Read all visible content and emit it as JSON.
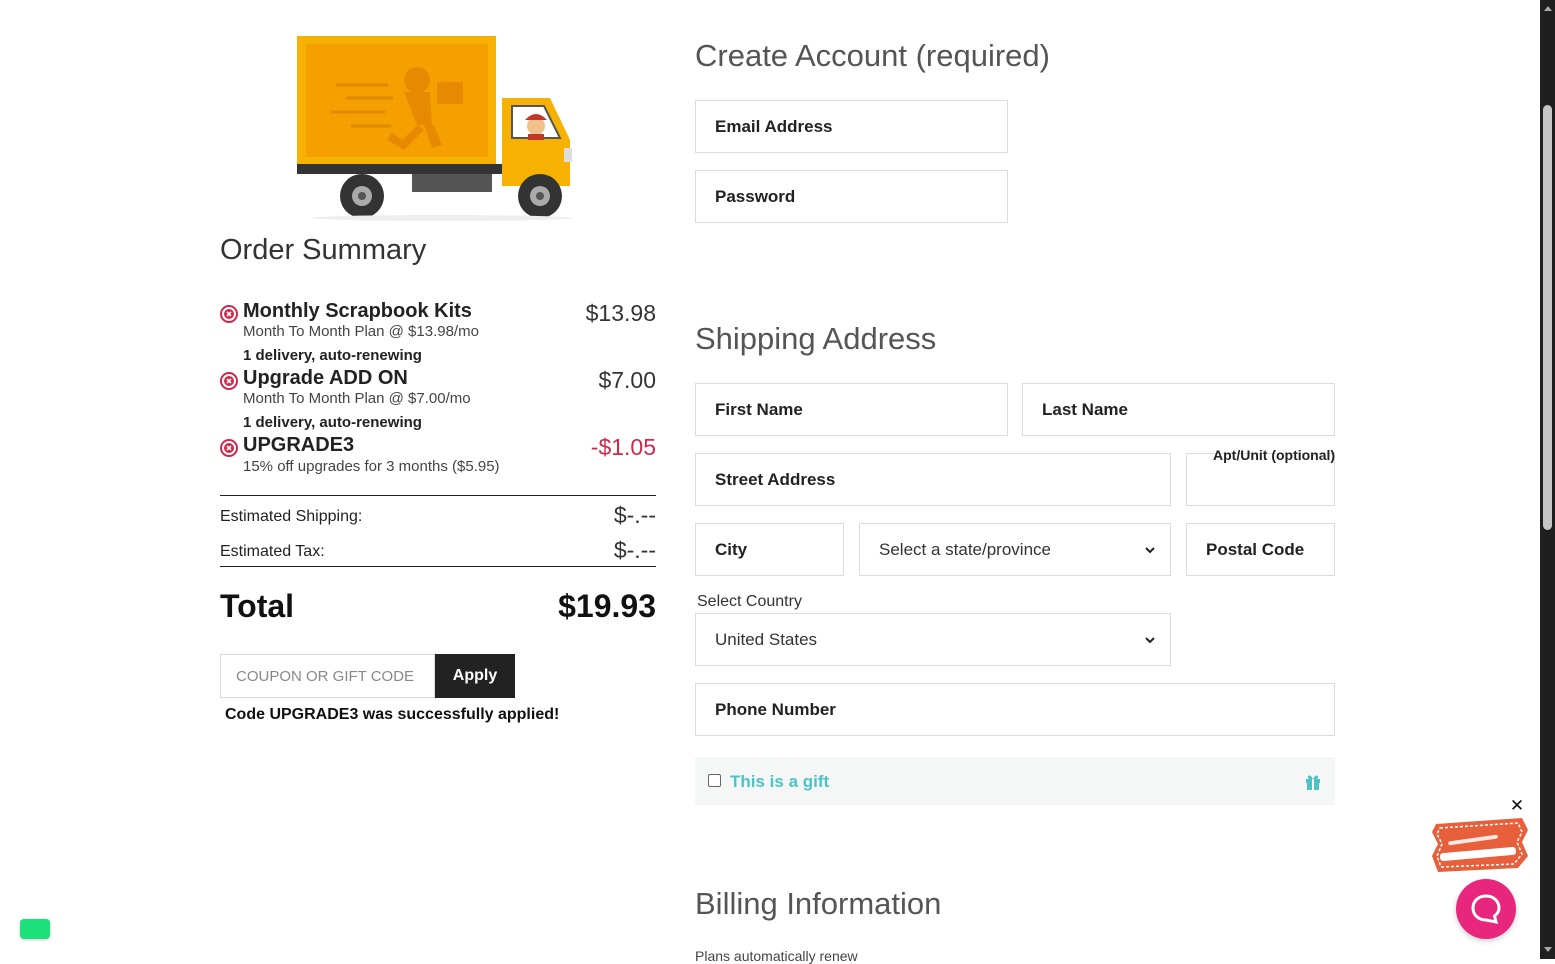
{
  "order_summary": {
    "title": "Order Summary",
    "items": [
      {
        "name": "Monthly Scrapbook Kits",
        "plan": "Month To Month Plan @ $13.98/mo",
        "delivery": "1 delivery, auto-renewing",
        "price": "$13.98"
      },
      {
        "name": "Upgrade ADD ON",
        "plan": "Month To Month Plan @ $7.00/mo",
        "delivery": "1 delivery, auto-renewing",
        "price": "$7.00"
      },
      {
        "name": "UPGRADE3",
        "plan": "15% off upgrades for 3 months ($5.95)",
        "price": "-$1.05"
      }
    ],
    "shipping_label": "Estimated Shipping:",
    "shipping_value": "$-.--",
    "tax_label": "Estimated Tax:",
    "tax_value": "$-.--",
    "total_label": "Total",
    "total_value": "$19.93",
    "coupon_placeholder": "COUPON OR GIFT CODE",
    "apply_label": "Apply",
    "success_message": "Code UPGRADE3 was successfully applied!"
  },
  "account": {
    "title": "Create Account (required)",
    "email_placeholder": "Email Address",
    "password_placeholder": "Password"
  },
  "shipping": {
    "title": "Shipping Address",
    "first_name": "First Name",
    "last_name": "Last Name",
    "street": "Street Address",
    "apt_label": "Apt/Unit (optional)",
    "city": "City",
    "state_select": "Select a state/province",
    "postal": "Postal Code",
    "country_label": "Select Country",
    "country_value": "United States",
    "phone": "Phone Number",
    "gift_label": "This is a gift"
  },
  "billing": {
    "title": "Billing Information",
    "subtext": "Plans automatically renew"
  },
  "chat": {
    "close": "✕"
  },
  "colors": {
    "accent": "#4cc3c6",
    "remove_red": "#d0284a",
    "chat_pink": "#e8267e",
    "truck_orange": "#f7a600"
  }
}
